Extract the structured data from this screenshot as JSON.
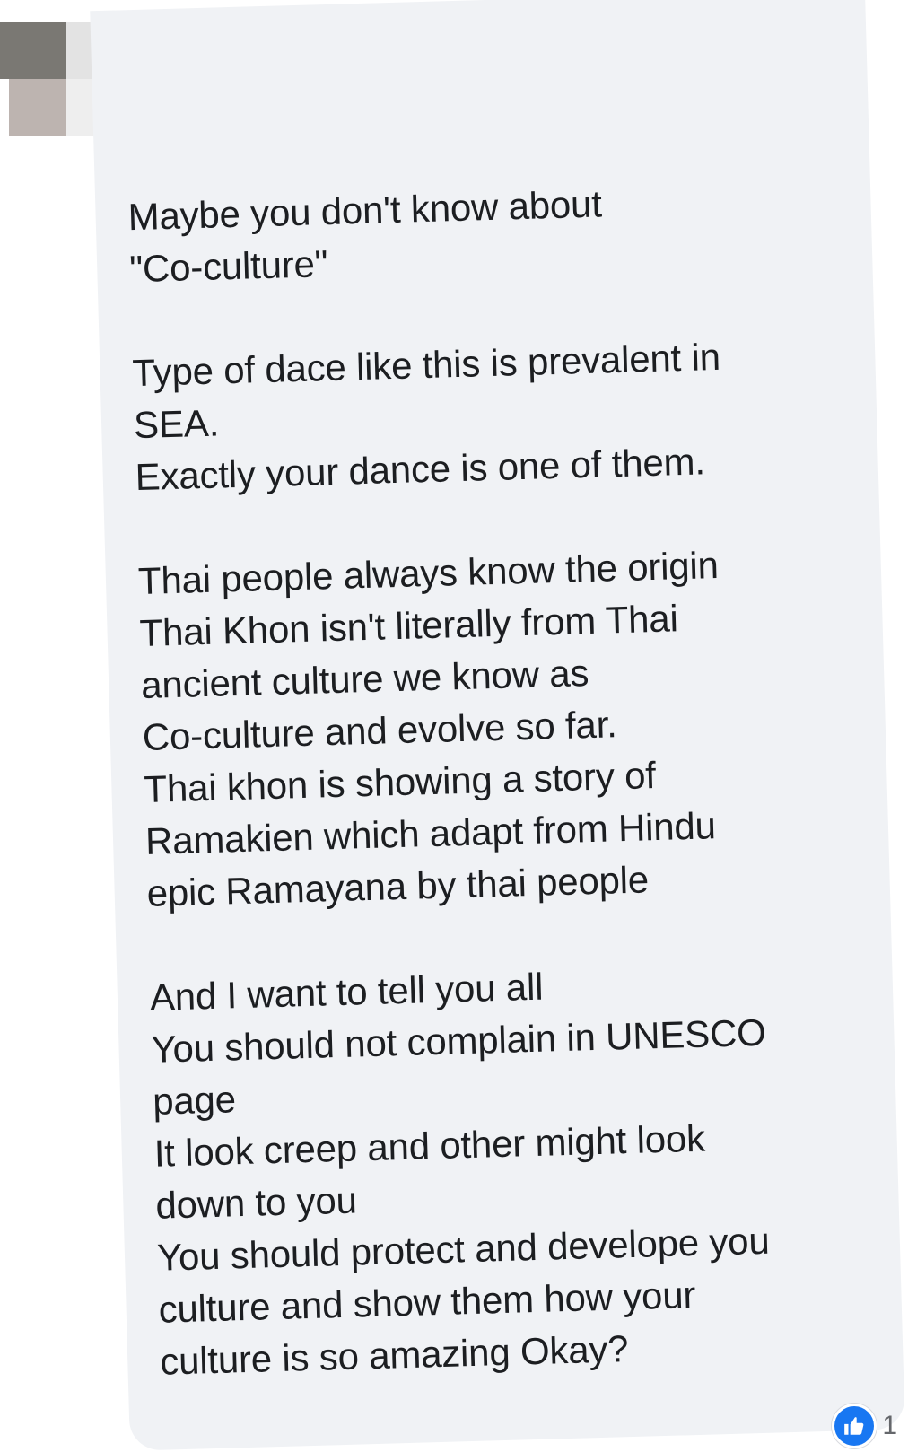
{
  "comment": {
    "paragraphs": [
      {
        "lines": [
          "Maybe you don't know about",
          "\"Co-culture\""
        ]
      },
      {
        "lines": [
          "Type of dace like this is prevalent in",
          "SEA.",
          "Exactly your dance is one of them."
        ]
      },
      {
        "lines": [
          "Thai people always know the origin",
          "Thai Khon isn't literally from Thai",
          "ancient culture we know as",
          "Co-culture and evolve so far.",
          "Thai khon is showing a story of",
          "Ramakien which adapt from Hindu",
          "epic Ramayana by thai people"
        ]
      },
      {
        "lines": [
          "And I want to tell you all",
          "You should not complain in UNESCO",
          "page",
          "It look creep and other might look",
          "down to you",
          "You should protect and develope you",
          "culture and show them how your",
          "culture is so amazing Okay?"
        ]
      }
    ]
  },
  "reactions": {
    "icon": "like-icon",
    "count": "1",
    "color": "#1877f2"
  },
  "colors": {
    "bubble": "#f0f2f5",
    "text": "#1c1e21"
  }
}
